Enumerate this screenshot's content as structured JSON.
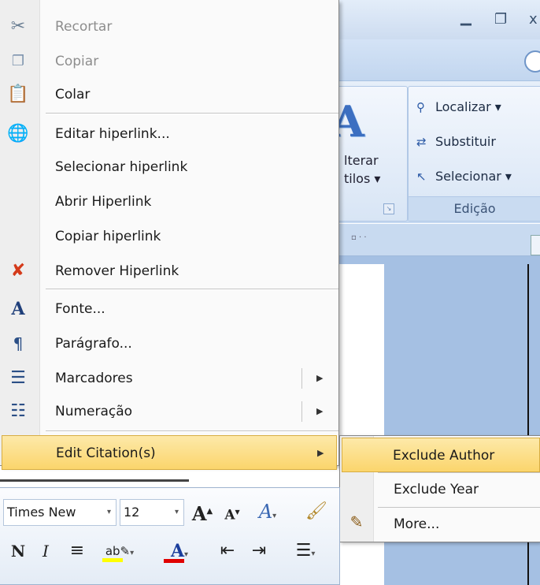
{
  "context_menu": {
    "items": [
      {
        "label": "Recortar",
        "icon": "scissors-icon",
        "disabled": true
      },
      {
        "label": "Copiar",
        "icon": "copy-icon",
        "disabled": true
      },
      {
        "label": "Colar",
        "icon": "paste-icon",
        "disabled": false
      },
      {
        "label": "Editar hiperlink...",
        "icon": "hyperlink-globe-icon",
        "disabled": false
      },
      {
        "label": "Selecionar hiperlink",
        "icon": "",
        "disabled": false
      },
      {
        "label": "Abrir Hiperlink",
        "icon": "",
        "disabled": false
      },
      {
        "label": "Copiar hiperlink",
        "icon": "",
        "disabled": false
      },
      {
        "label": "Remover Hiperlink",
        "icon": "remove-hyperlink-icon",
        "disabled": false
      },
      {
        "label": "Fonte...",
        "icon": "font-icon",
        "disabled": false
      },
      {
        "label": "Parágrafo...",
        "icon": "paragraph-icon",
        "disabled": false
      },
      {
        "label": "Marcadores",
        "icon": "bullets-icon",
        "disabled": false,
        "submenu": true
      },
      {
        "label": "Numeração",
        "icon": "numbering-icon",
        "disabled": false,
        "submenu": true
      },
      {
        "label": "Edit Citation(s)",
        "icon": "",
        "disabled": false,
        "submenu": true,
        "highlighted": true
      }
    ]
  },
  "submenu": {
    "items": [
      {
        "label": "Exclude Author",
        "highlighted": true
      },
      {
        "label": "Exclude Year"
      },
      {
        "label": "More...",
        "icon": "edit-pencil-icon"
      }
    ]
  },
  "ribbon": {
    "styles_label_line1": "lterar",
    "styles_label_line2": "tilos ▾",
    "edicao": {
      "localizar": "Localizar ▾",
      "substituir": "Substituir",
      "selecionar": "Selecionar ▾",
      "group_label": "Edição"
    }
  },
  "mini_toolbar": {
    "font_name": "Times New",
    "font_size": "12"
  },
  "colors": {
    "highlight": "#fbd56c",
    "highlight_border": "#d7ad42",
    "ribbon_blue": "#c6d9f1",
    "text_highlight_color": "#ffff00",
    "font_color": "#e00000"
  }
}
